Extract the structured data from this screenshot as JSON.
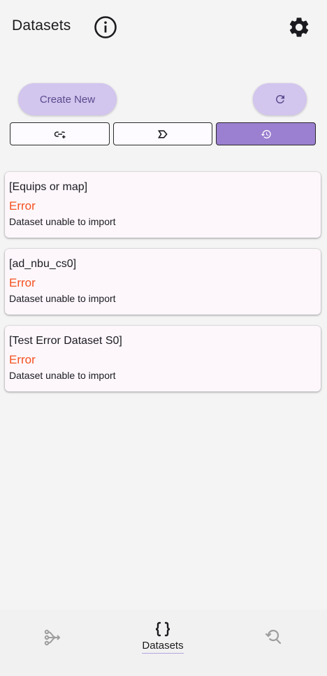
{
  "header": {
    "title": "Datasets",
    "info_icon": "info-circle-icon",
    "settings_icon": "gear-icon"
  },
  "toolbar": {
    "create_label": "Create New",
    "refresh_icon": "refresh-icon"
  },
  "segments": [
    {
      "icon": "link-add-icon",
      "selected": false
    },
    {
      "icon": "label-tag-icon",
      "selected": false
    },
    {
      "icon": "history-icon",
      "selected": true
    }
  ],
  "datasets": [
    {
      "name": "[Equips or map]",
      "status": "Error",
      "message": "Dataset unable to import"
    },
    {
      "name": "[ad_nbu_cs0]",
      "status": "Error",
      "message": "Dataset unable to import"
    },
    {
      "name": "[Test Error Dataset S0]",
      "status": "Error",
      "message": "Dataset unable to import"
    }
  ],
  "bottom_nav": {
    "items": [
      {
        "icon": "flow-branch-icon",
        "label": ""
      },
      {
        "icon": "braces-icon",
        "label": "Datasets",
        "active": true
      },
      {
        "icon": "search-history-icon",
        "label": ""
      }
    ]
  },
  "colors": {
    "accent": "#9b7fd0",
    "tonal_button": "#d2c5ee",
    "error": "#f4511e",
    "card_bg": "#fdf7fc"
  }
}
